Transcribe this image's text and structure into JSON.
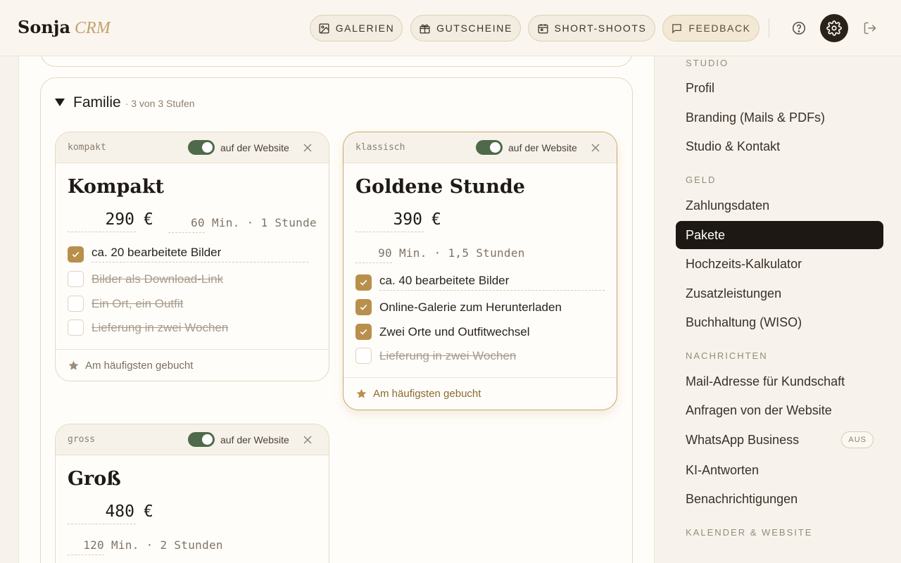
{
  "brand": {
    "name": "Sonja",
    "sub": "CRM"
  },
  "nav": [
    {
      "label": "GALERIEN",
      "icon": "image-icon"
    },
    {
      "label": "GUTSCHEINE",
      "icon": "gift-icon"
    },
    {
      "label": "SHORT-SHOOTS",
      "icon": "calendar-icon"
    },
    {
      "label": "FEEDBACK",
      "icon": "message-icon"
    }
  ],
  "group": {
    "title": "Familie",
    "meta": "· 3 von 3 Stufen"
  },
  "packages": [
    {
      "slug": "kompakt",
      "toggle_label": "auf der Website",
      "website": true,
      "name": "Kompakt",
      "price": "290",
      "currency": "€",
      "minutes": "60",
      "min_unit": "Min.",
      "hours": "· 1 Stunde",
      "features": [
        {
          "text": "ca. 20 bearbeitete Bilder",
          "checked": true
        },
        {
          "text": "Bilder als Download-Link",
          "checked": false
        },
        {
          "text": "Ein Ort, ein Outfit",
          "checked": false
        },
        {
          "text": "Lieferung in zwei Wochen",
          "checked": false
        }
      ],
      "footer": "Am häufigsten gebucht",
      "most_booked": false
    },
    {
      "slug": "klassisch",
      "toggle_label": "auf der Website",
      "website": true,
      "name": "Goldene Stunde",
      "price": "390",
      "currency": "€",
      "minutes": "90",
      "min_unit": "Min.",
      "hours": "· 1,5 Stunden",
      "features": [
        {
          "text": "ca. 40 bearbeitete Bilder",
          "checked": true
        },
        {
          "text": "Online-Galerie zum Herunterladen",
          "checked": true
        },
        {
          "text": "Zwei Orte und Outfitwechsel",
          "checked": true
        },
        {
          "text": "Lieferung in zwei Wochen",
          "checked": false
        }
      ],
      "footer": "Am häufigsten gebucht",
      "most_booked": true
    },
    {
      "slug": "gross",
      "toggle_label": "auf der Website",
      "website": true,
      "name": "Groß",
      "price": "480",
      "currency": "€",
      "minutes": "120",
      "min_unit": "Min.",
      "hours": "· 2 Stunden"
    }
  ],
  "sidebar": {
    "sections": [
      {
        "title": "STUDIO",
        "items": [
          "Profil",
          "Branding (Mails & PDFs)",
          "Studio & Kontakt"
        ]
      },
      {
        "title": "GELD",
        "items": [
          "Zahlungsdaten",
          "Pakete",
          "Hochzeits-Kalkulator",
          "Zusatzleistungen",
          "Buchhaltung (WISO)"
        ]
      },
      {
        "title": "NACHRICHTEN",
        "items": [
          "Mail-Adresse für Kundschaft",
          "Anfragen von der Website",
          "WhatsApp Business",
          "KI-Antworten",
          "Benachrichtigungen"
        ]
      },
      {
        "title": "KALENDER & WEBSITE",
        "items": []
      }
    ],
    "active_item": "Pakete",
    "whatsapp_badge": "AUS"
  },
  "colors": {
    "accent": "#b8904c",
    "active_bg": "#1d1813",
    "toggle_on": "#4f6a4a"
  }
}
